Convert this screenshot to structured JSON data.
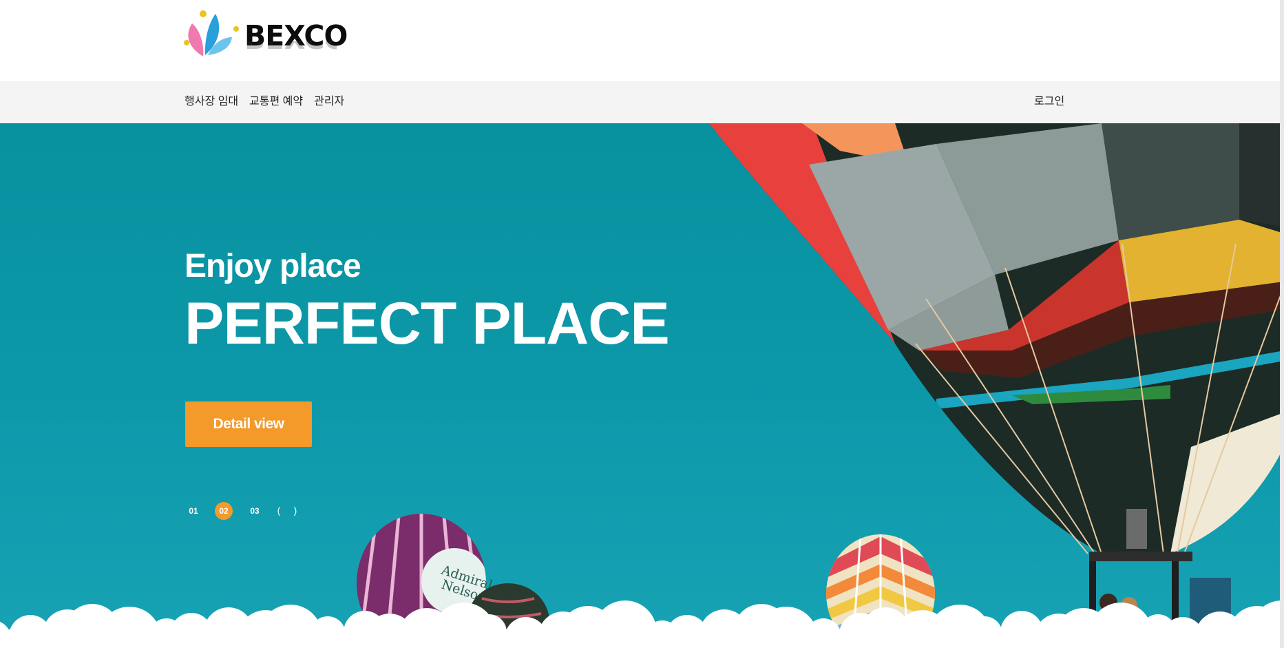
{
  "brand": {
    "logo_text": "BEXCO",
    "colors": {
      "pink": "#f07ab0",
      "blue": "#3ba6e0",
      "yellow": "#f0d23a"
    }
  },
  "nav": {
    "items": [
      {
        "label": "행사장 임대"
      },
      {
        "label": "교통편 예약"
      },
      {
        "label": "관리자"
      }
    ],
    "login_label": "로그인"
  },
  "hero": {
    "subtitle": "Enjoy place",
    "title": "PERFECT PLACE",
    "cta_label": "Detail view",
    "background_color": "#0d99aa",
    "accent_color": "#f39a2b",
    "balloon_text": [
      "Admiral",
      "Nelson's"
    ],
    "slider": {
      "pages": [
        "01",
        "02",
        "03"
      ],
      "active_index": 1,
      "prev_icon": "(",
      "next_icon": ")"
    }
  }
}
